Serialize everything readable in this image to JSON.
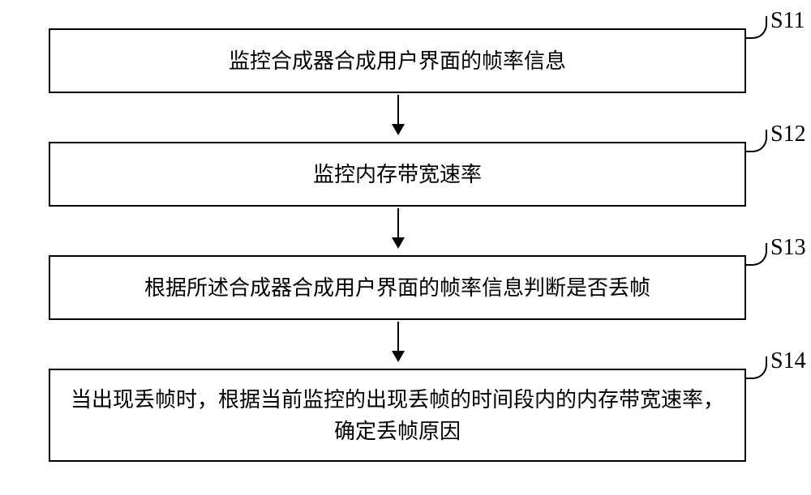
{
  "diagram": {
    "type": "flowchart",
    "steps": [
      {
        "id": "S11",
        "label": "S11",
        "text": "监控合成器合成用户界面的帧率信息"
      },
      {
        "id": "S12",
        "label": "S12",
        "text": "监控内存带宽速率"
      },
      {
        "id": "S13",
        "label": "S13",
        "text": "根据所述合成器合成用户界面的帧率信息判断是否丢帧"
      },
      {
        "id": "S14",
        "label": "S14",
        "text": "当出现丢帧时，根据当前监控的出现丢帧的时间段内的内存带宽速率，确定丢帧原因"
      }
    ]
  }
}
